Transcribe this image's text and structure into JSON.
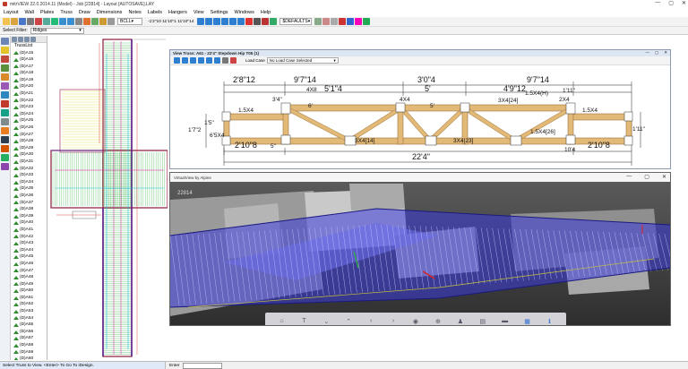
{
  "window": {
    "title": "mitrVIEW 22.0.2014.11 (Model) - Job [22814] - Layout [AUTOSAVE].LAY",
    "min": "—",
    "max": "▢",
    "close": "✕"
  },
  "menu": [
    "Layout",
    "Wall",
    "Plates",
    "Truss",
    "Draw",
    "Dimensions",
    "Notes",
    "Labels",
    "Hangers",
    "View",
    "Settings",
    "Windows",
    "Help"
  ],
  "toolbar1": {
    "layer_combo": "BCLL",
    "coord_text": "-1'2\"10  11'10\"1  11'10\"14",
    "zoom_combo": "$DEFAULTS"
  },
  "toolbar2": {
    "label": "Select Filter:",
    "filter_value": "Ridges"
  },
  "truss_list": {
    "root": "TrussList",
    "items": [
      "(D)A15",
      "(D)A16",
      "(D)A17",
      "(D)A18",
      "(D)A19",
      "(D)A20",
      "(D)A21",
      "(D)A22",
      "(D)A23",
      "(D)A24",
      "(D)A25",
      "(D)A26",
      "(D)A27",
      "(D)A28",
      "(D)A29",
      "(D)A30",
      "(D)A31",
      "(D)A32",
      "(D)A33",
      "(D)A34",
      "(D)A35",
      "(D)A36",
      "(D)A37",
      "(D)A38",
      "(D)A39",
      "(D)A40",
      "(D)A41",
      "(D)A42",
      "(D)A43",
      "(D)A44",
      "(D)A45",
      "(D)A46",
      "(D)A47",
      "(D)A48",
      "(D)A49",
      "(D)A50",
      "(D)A51",
      "(D)A52",
      "(D)A53",
      "(D)A54",
      "(D)A55",
      "(D)A56",
      "(D)A57",
      "(D)A58",
      "(D)A59",
      "(D)A60",
      "(D)A61"
    ],
    "selected_index": 46
  },
  "truss_view": {
    "title": "View Truss: A61 - 22'4\" Stepdown Hip T05 (1)",
    "load_case_label": "Load Case",
    "load_case_value": "No Load Case Selected",
    "dims": {
      "top_left_panel": "2'8\"12",
      "top_left_mid": "9'7\"14",
      "top_center": "3'0\"4",
      "top_right": "9'7\"14",
      "second_left": "5'1\"4",
      "second_center": "5'",
      "second_right": "4'9\"12",
      "small_4x8": "4X8",
      "pitch_right": "1.5X4(H)",
      "plate_3x4_24": "3X4[24]",
      "overall": "22'4\"",
      "bottom_left": "2'10\"8",
      "bottom_right": "2'10\"8",
      "height_left": "1'7\"2",
      "height_right": "1'11\"",
      "plate_3x4_14": "3X4[14]",
      "plate_3x4_23": "3X4[23]",
      "plate_15x4_26": "1.5X4[26]",
      "plate_2x4": "2X4",
      "plate_15x4": "1.5X4",
      "plate_4x4": "4X4",
      "plate_15x4b": "1.5X4",
      "small_15": "1'5\"",
      "small_5": "5\"",
      "left_heel": "6'5X4",
      "vert_a": "3'4\"",
      "vert_b": "1'11\"",
      "vert_c": "10'4",
      "s_1": "6'",
      "s_2": "5'"
    }
  },
  "virtual_view": {
    "title": "VirtualView by Alpine",
    "job_label": "22814"
  },
  "status": {
    "hint": "Select Truss to View. <Enter> To Go To iDesign.",
    "enter_label": "Enter"
  },
  "colors": {
    "accent": "#2f6fd6",
    "truss_wood": "#e3b977",
    "vv_blue": "#2a2ad4"
  }
}
